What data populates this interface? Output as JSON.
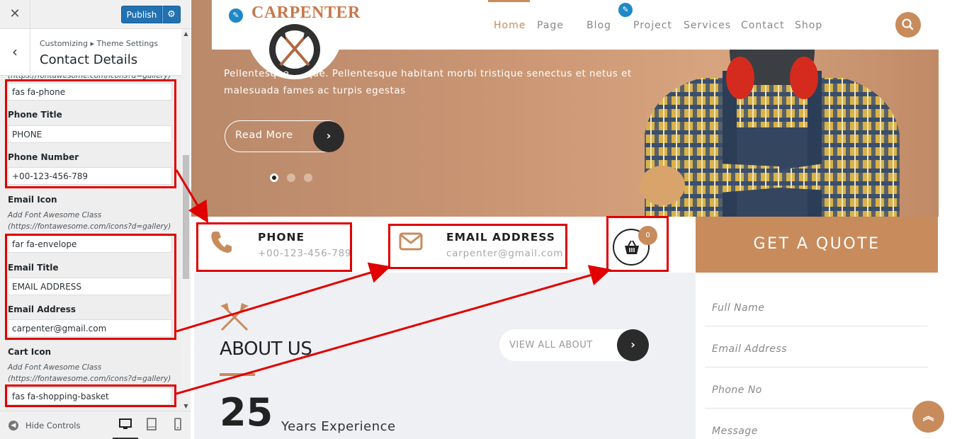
{
  "customizer": {
    "close_glyph": "✕",
    "publish_label": "Publish",
    "gear_glyph": "⚙",
    "back_glyph": "‹",
    "breadcrumb": "Customizing ▸ Theme Settings",
    "section_title": "Contact Details",
    "top_cut_text": "(https://fontawesome.com/icons?d=gallery)",
    "fields": {
      "phone_icon_value": "fas fa-phone",
      "phone_title_label": "Phone Title",
      "phone_title_value": "PHONE",
      "phone_number_label": "Phone Number",
      "phone_number_value": "+00-123-456-789",
      "email_icon_label": "Email Icon",
      "email_icon_desc": "Add Font Awesome Class (https://fontawesome.com/icons?d=gallery)",
      "email_icon_value": "far fa-envelope",
      "email_title_label": "Email Title",
      "email_title_value": "EMAIL ADDRESS",
      "email_address_label": "Email Address",
      "email_address_value": "carpenter@gmail.com",
      "cart_icon_label": "Cart Icon",
      "cart_icon_desc": "Add Font Awesome Class (https://fontawesome.com/icons?d=gallery)",
      "cart_icon_value": "fas fa-shopping-basket"
    },
    "footer": {
      "hide_controls_label": "Hide Controls",
      "devices": [
        "desktop-icon",
        "tablet-icon",
        "mobile-icon"
      ]
    }
  },
  "site": {
    "logo_text": "CARPENTER",
    "nav": [
      "Home",
      "Page",
      "Blog",
      "Project",
      "Services",
      "Contact",
      "Shop"
    ],
    "hero_text": "Pellentesque ... que. Pellentesque habitant morbi tristique senectus et netus et malesuada fames ac turpis egestas",
    "read_more_label": "Read More",
    "slider_dots": 3,
    "phone_title": "PHONE",
    "phone_value": "+00-123-456-789",
    "email_title": "EMAIL ADDRESS",
    "email_value": "carpenter@gmail.com",
    "cart_count": "0",
    "quote_title": "GET A QUOTE",
    "quote_fields": [
      "Full Name",
      "Email Address",
      "Phone No",
      "Message"
    ],
    "about_title": "ABOUT US",
    "view_all_label": "VIEW ALL ABOUT",
    "years_number": "25",
    "years_label": "Years Experience"
  },
  "colors": {
    "accent": "#c88b5c",
    "annotation_red": "#e00000",
    "wp_blue": "#2271b1"
  }
}
